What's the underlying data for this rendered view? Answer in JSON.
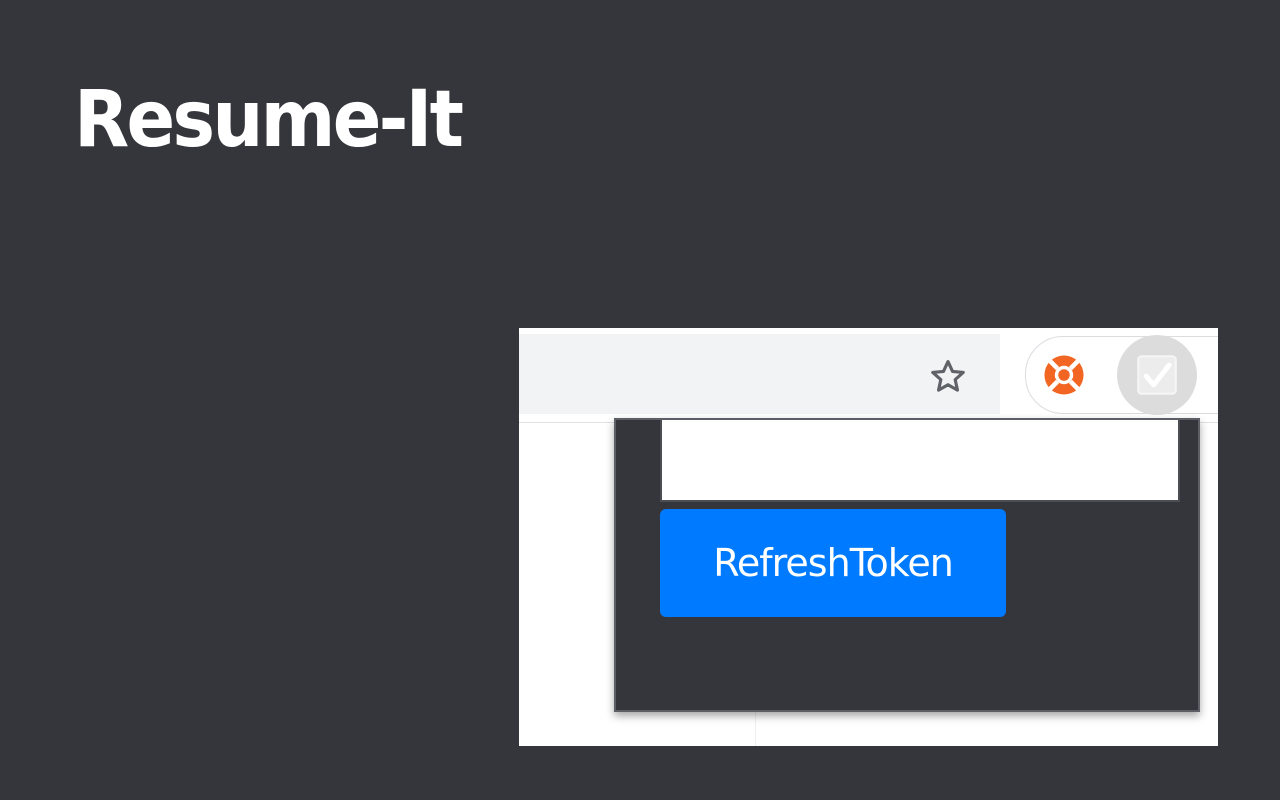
{
  "app": {
    "title": "Resume-It"
  },
  "browser": {
    "toolbar": {
      "bookmark_icon": "star-outline-icon",
      "extension_icons": [
        "lifebuoy-icon",
        "checkbox-icon"
      ]
    }
  },
  "popup": {
    "token_input": {
      "value": "",
      "placeholder": ""
    },
    "refresh_button_label": "RefreshToken"
  },
  "colors": {
    "background": "#35363c",
    "button_primary": "#007bff",
    "lifebuoy": "#f26522",
    "title_text": "#ffffff"
  }
}
